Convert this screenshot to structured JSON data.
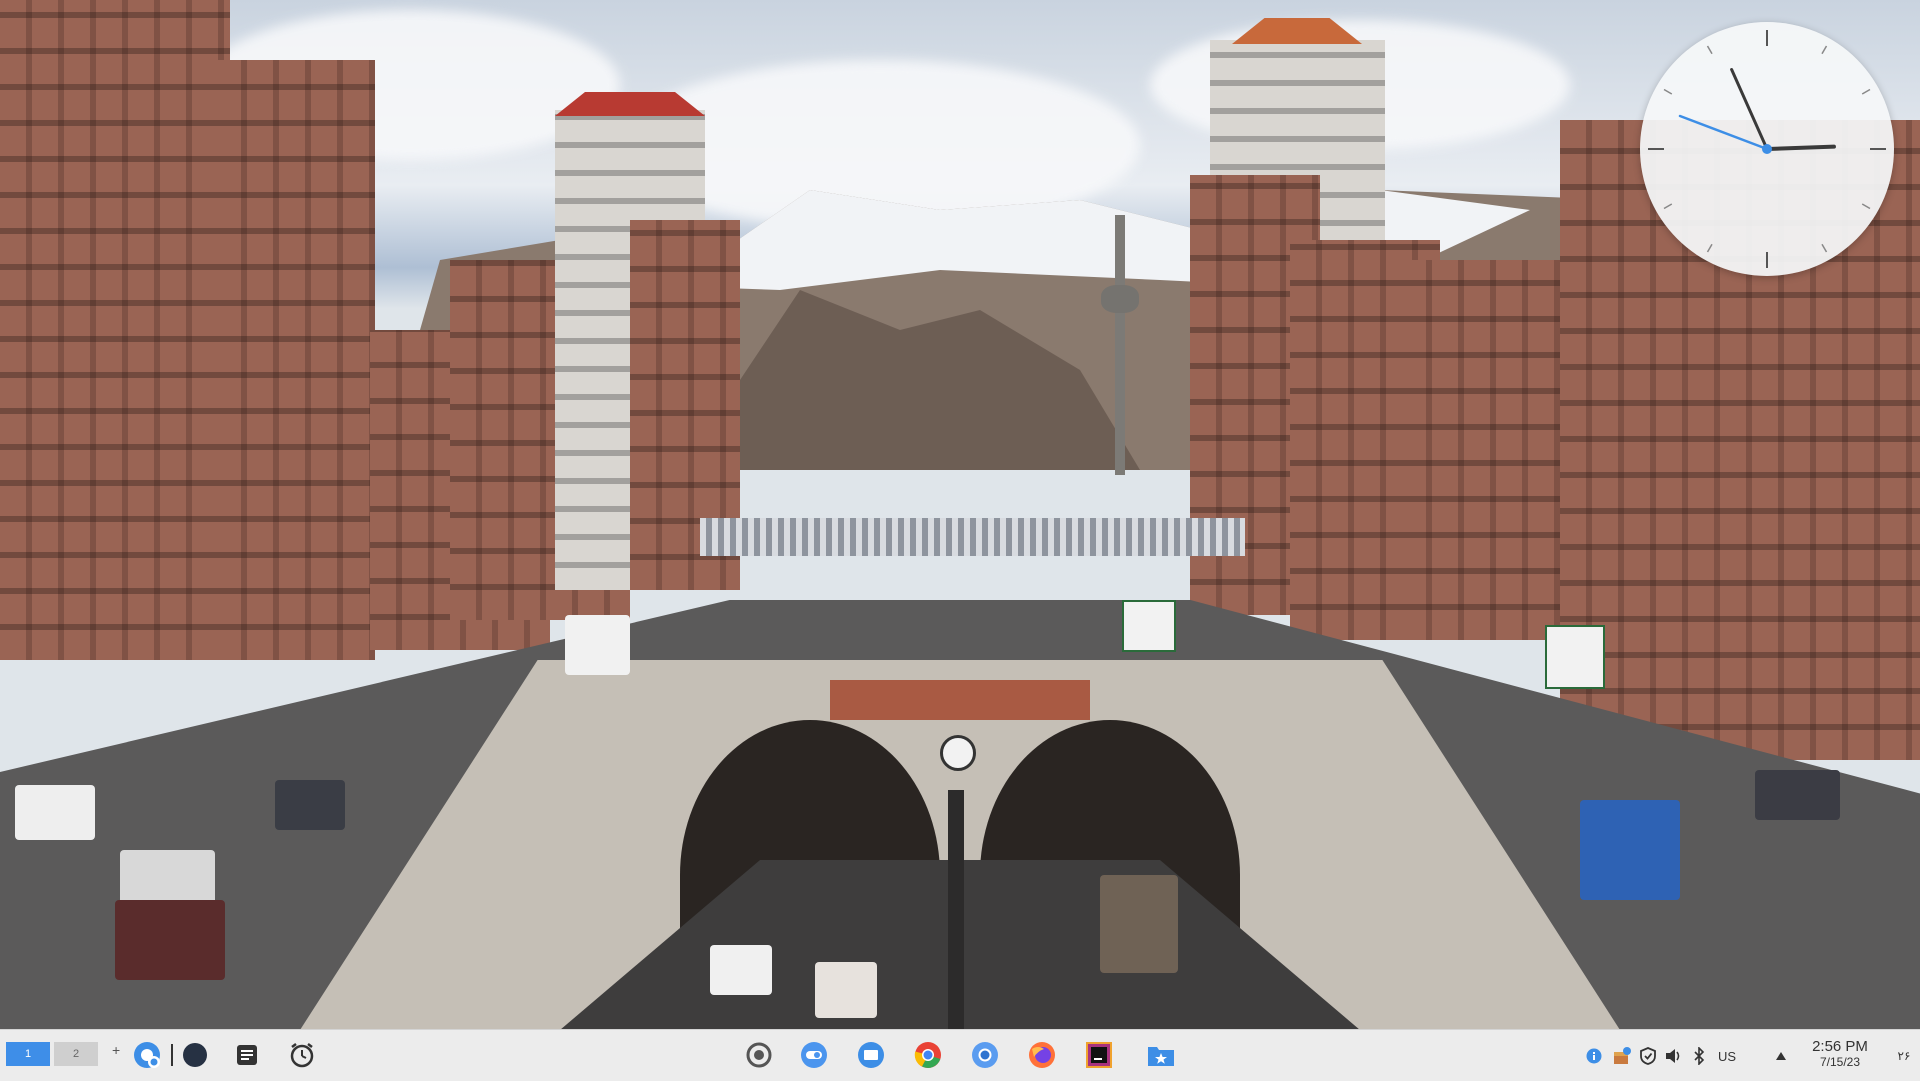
{
  "desktop": {
    "wallpaper": "city-tunnel-mountain-photo",
    "clock_widget": {
      "hour": 2,
      "minute": 56
    }
  },
  "taskbar": {
    "pager": {
      "desktops": [
        "1",
        "2"
      ],
      "active": "1"
    },
    "add_desktop_label": "+",
    "launchers": [
      {
        "name": "application-launcher-icon"
      },
      {
        "name": "dark-circle-app-icon"
      },
      {
        "name": "notes-app-icon"
      },
      {
        "name": "alarm-clock-app-icon"
      }
    ],
    "dock_apps": [
      "record-circle-icon",
      "toggle-app-icon",
      "file-manager-icon",
      "chrome-icon",
      "chromium-icon",
      "firefox-icon",
      "terminal-app-icon",
      "starred-folder-icon"
    ],
    "tray": {
      "keyboard_layout": "US",
      "time": "2:56 PM",
      "date": "7/15/23",
      "locale_indicator": "۲۶"
    },
    "colors": {
      "active_desktop": "#3e8ee8",
      "bar_bg": "#ececec"
    }
  }
}
